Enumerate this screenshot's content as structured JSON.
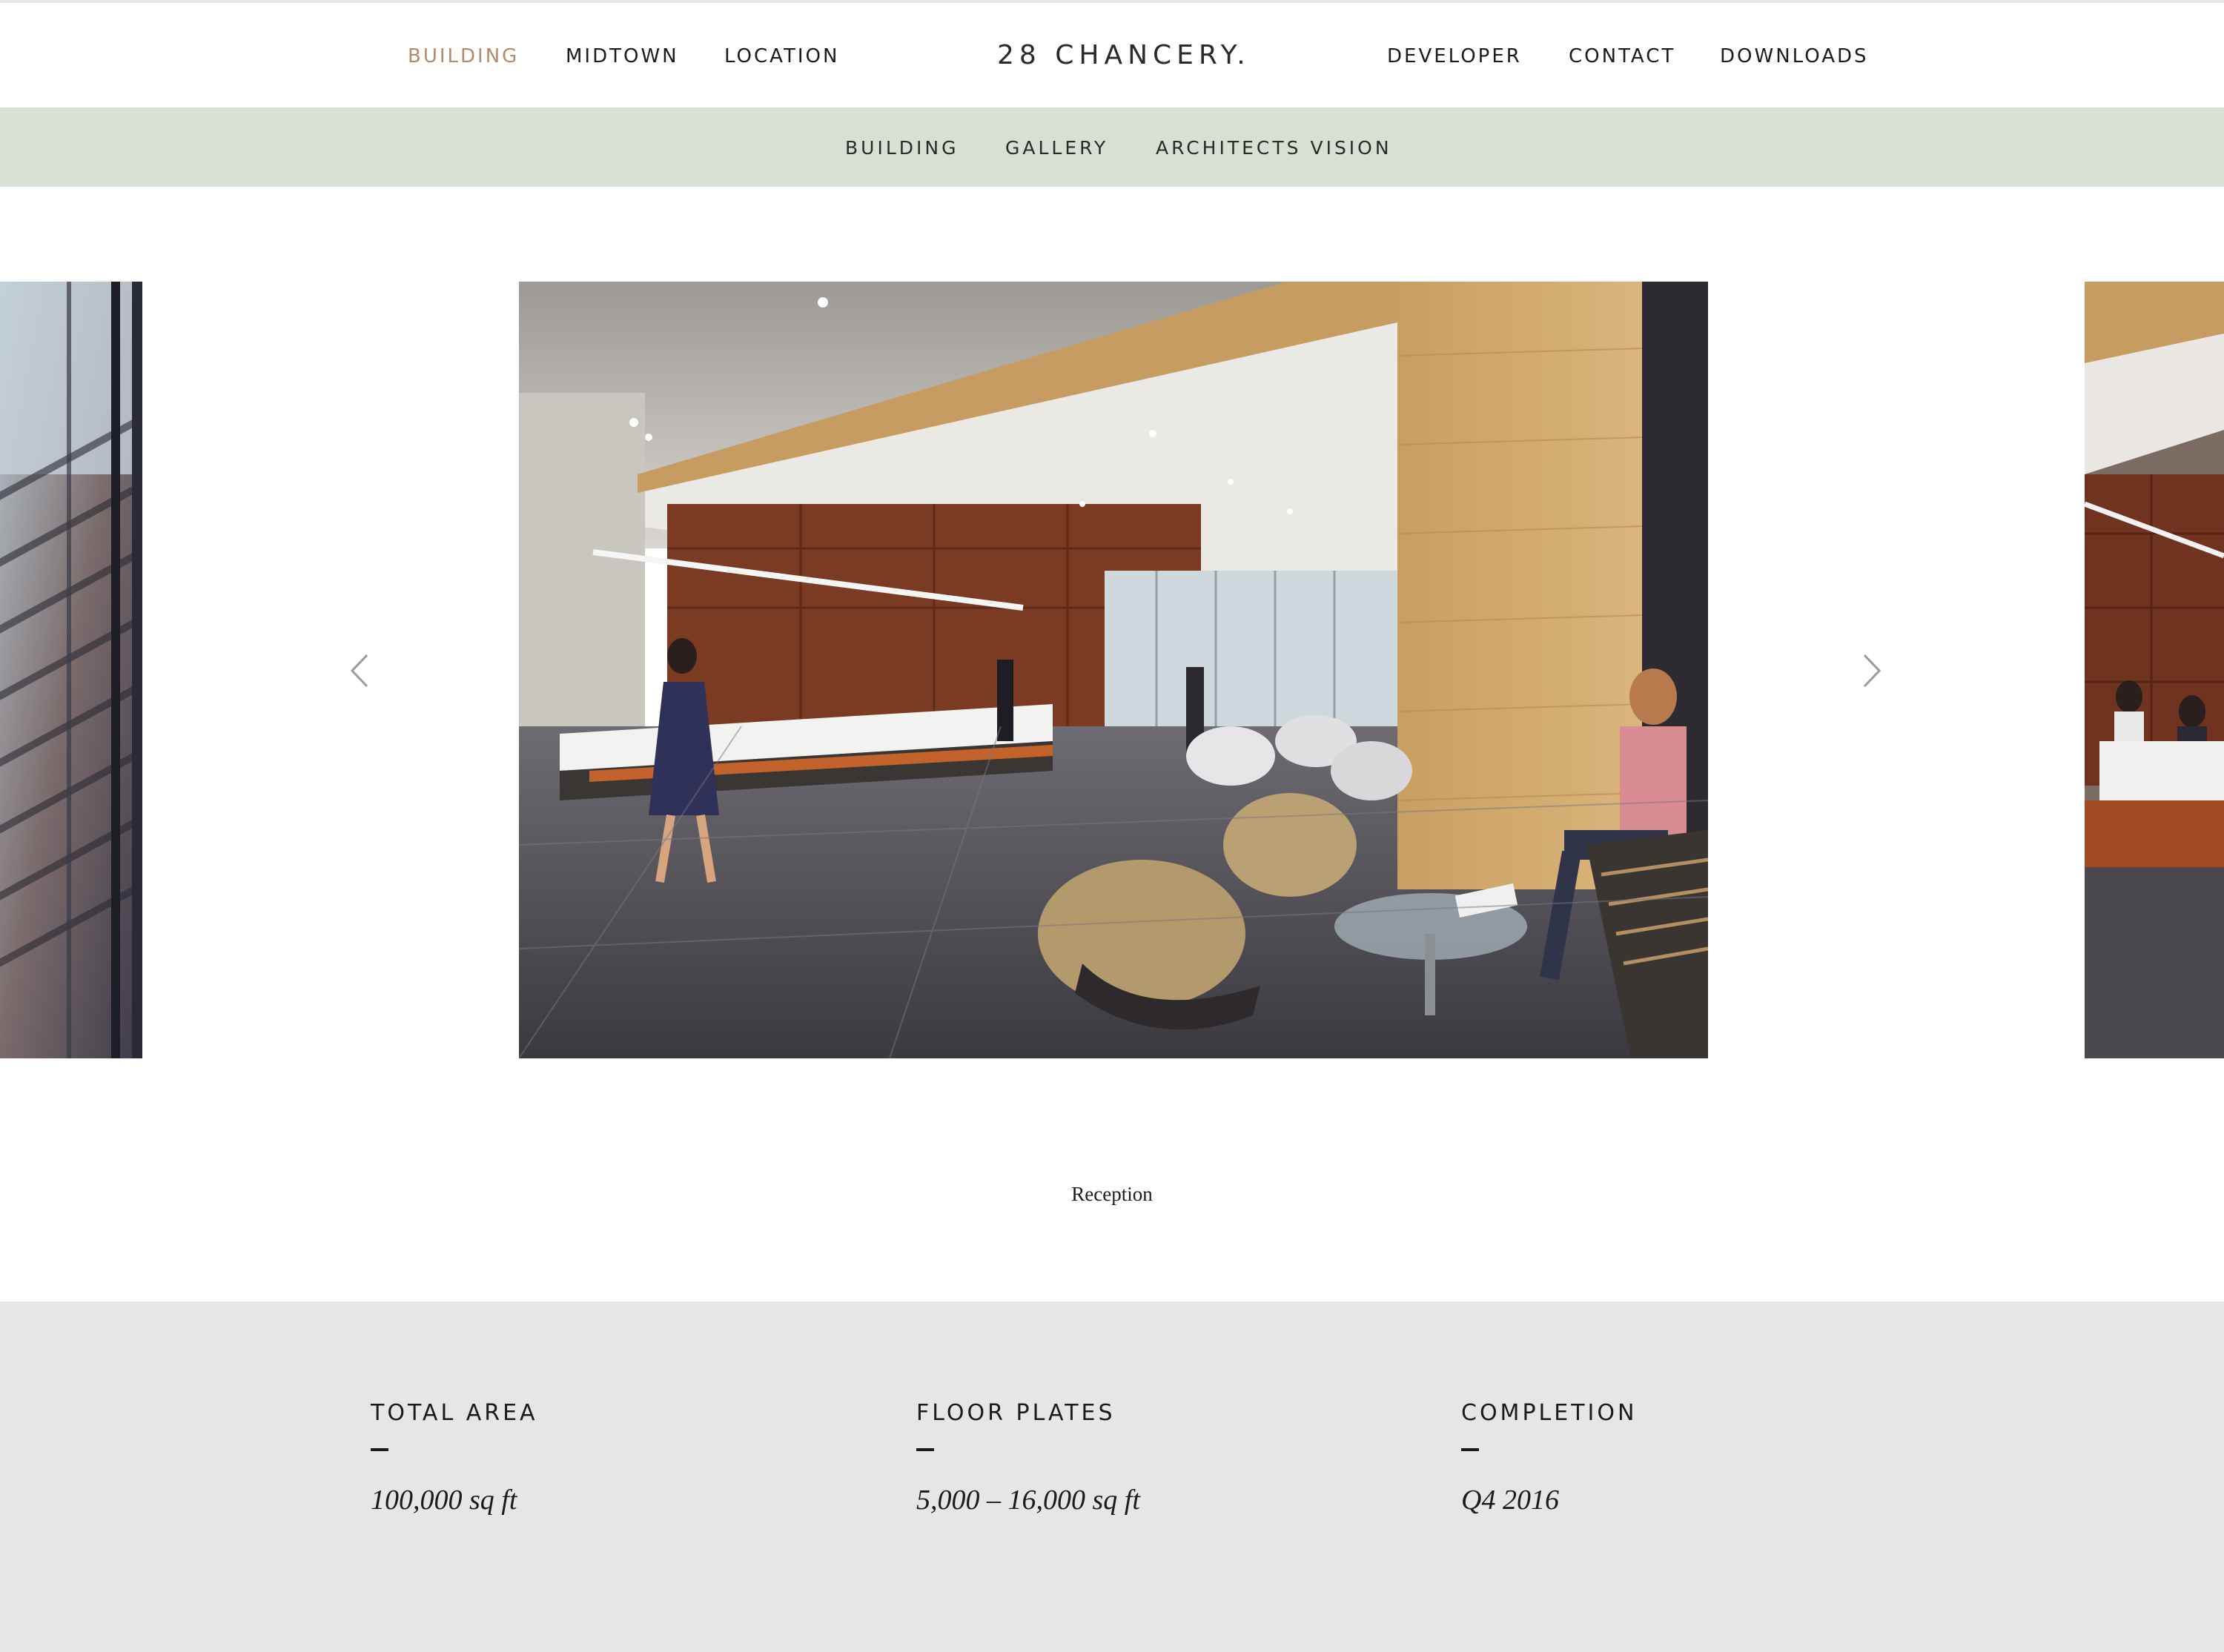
{
  "brand": {
    "logo_text": "28 CHANCERY."
  },
  "nav": {
    "left": [
      {
        "label": "BUILDING",
        "active": true
      },
      {
        "label": "MIDTOWN",
        "active": false
      },
      {
        "label": "LOCATION",
        "active": false
      }
    ],
    "right": [
      {
        "label": "DEVELOPER"
      },
      {
        "label": "CONTACT"
      },
      {
        "label": "DOWNLOADS"
      }
    ]
  },
  "subnav": {
    "items": [
      {
        "label": "BUILDING"
      },
      {
        "label": "GALLERY"
      },
      {
        "label": "ARCHITECTS VISION"
      }
    ]
  },
  "carousel": {
    "caption": "Reception",
    "prev_arrow_icon": "chevron-left-icon",
    "next_arrow_icon": "chevron-right-icon"
  },
  "facts": [
    {
      "label": "TOTAL AREA",
      "value": "100,000 sq ft"
    },
    {
      "label": "FLOOR PLATES",
      "value": "5,000 – 16,000 sq ft"
    },
    {
      "label": "COMPLETION",
      "value": "Q4 2016"
    }
  ],
  "colors": {
    "active_nav": "#b58a6c",
    "subnav_bg": "#d8e0d4",
    "facts_bg": "#e6e6e6",
    "text": "#1b1b1b"
  }
}
